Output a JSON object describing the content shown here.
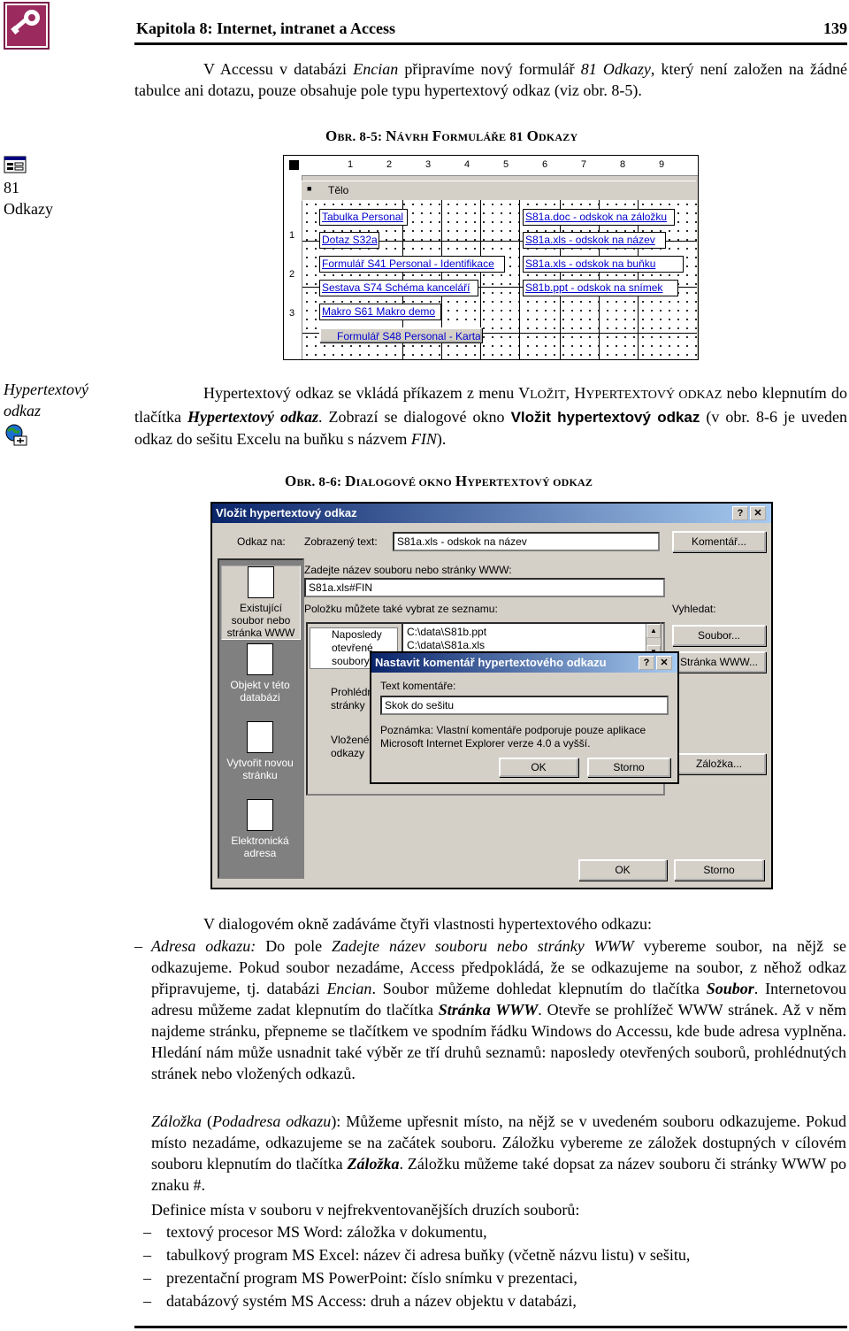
{
  "header": {
    "title": "Kapitola 8: Internet, intranet a Access",
    "page": "139"
  },
  "intro": {
    "pre": "V Accessu v databázi ",
    "db": "Encian",
    "mid": " připravíme nový formulář ",
    "form": "81 Odkazy",
    "post": ", který není založen na žádné tabulce ani dotazu, pouze obsahuje pole typu hypertextový odkaz (viz obr. 8-5)."
  },
  "fig1_caption": {
    "obr_o": "O",
    "obr_rest": "BR",
    "num": ". 8-5: ",
    "w1_n": "N",
    "w1_rest": "ÁVRH",
    "w2_f": "F",
    "w2_rest": "ORMULÁŘE",
    "w3": " 81 ",
    "w4_o": "O",
    "w4_rest": "DKAZY"
  },
  "side1": {
    "icon": "form-icon",
    "line1": "81",
    "line2": "Odkazy"
  },
  "form_design": {
    "ruler_numbers": [
      "1",
      "2",
      "3",
      "4",
      "5",
      "6",
      "7",
      "8",
      "9"
    ],
    "left_ruler": [
      "1",
      "2",
      "3"
    ],
    "section": "Tělo",
    "links_left": [
      "Tabulka Personal",
      "Dotaz S32a",
      "Formulář S41 Personal - Identifikace",
      "Sestava S74 Schéma kanceláří",
      "Makro S61 Makro demo",
      "Formulář S48 Personal - Karta"
    ],
    "links_right": [
      "S81a.doc - odskok na záložku",
      "S81a.xls - odskok na název",
      "S81a.xls - odskok na buňku",
      "S81b.ppt - odskok na snímek"
    ]
  },
  "side2": {
    "line1": "Hypertextový",
    "line2": "odkaz",
    "icon": "hyperlink-icon"
  },
  "para2": {
    "pre": "Hypertextový odkaz se vkládá příkazem z menu ",
    "menu1_cap": "V",
    "menu1_rest": "LOŽIT",
    "sep": ", ",
    "menu2_cap": "H",
    "menu2_rest": "YPERTEXTOVÝ ODKAZ",
    "mid": " nebo klepnutím do tlačítka ",
    "btn": "Hypertextový odkaz",
    "mid2": ". Zobrazí se dialogové okno ",
    "dlg": "Vložit hypertextový odkaz",
    "post1": " (v obr. 8-6 je uveden odkaz do sešitu Excelu na buňku s názvem ",
    "fin": "FIN",
    "post2": ")."
  },
  "fig2_caption": {
    "obr_o": "O",
    "obr_rest": "BR",
    "num": ". 8-6: ",
    "w1_d": "D",
    "w1_rest": "IALOGOVÉ OKNO",
    "w2_h": "H",
    "w2_rest": "YPERTEXTOVÝ ODKAZ"
  },
  "dialog": {
    "title": "Vložit hypertextový odkaz",
    "help": "?",
    "close": "✕",
    "link_to": "Odkaz na:",
    "display_text_label": "Zobrazený text:",
    "display_text_value": "S81a.xls - odskok na název",
    "comment_btn": "Komentář...",
    "file_label": "Zadejte název souboru nebo stránky WWW:",
    "file_value": "S81a.xls#FIN",
    "list_label": "Položku můžete také vybrat ze seznamu:",
    "search_label": "Vyhledat:",
    "file_btn": "Soubor...",
    "web_btn": "Stránka WWW...",
    "bookmark_btn": "Záložka...",
    "ok": "OK",
    "cancel": "Storno",
    "side_items": [
      {
        "l1": "Existující",
        "l2": "soubor nebo",
        "l3": "stránka WWW"
      },
      {
        "l1": "Objekt v této",
        "l2": "databázi",
        "l3": ""
      },
      {
        "l1": "Vytvořit novou",
        "l2": "stránku",
        "l3": ""
      },
      {
        "l1": "Elektronická",
        "l2": "adresa",
        "l3": ""
      }
    ],
    "tabs": [
      {
        "l1": "Naposledy",
        "l2": "otevřené",
        "l3": "soubory"
      },
      {
        "l1": "Prohlédnuté",
        "l2": "stránky"
      },
      {
        "l1": "Vložené",
        "l2": "odkazy"
      }
    ],
    "files": [
      "C:\\data\\S81b.ppt",
      "C:\\data\\S81a.xls"
    ]
  },
  "subdialog": {
    "title": "Nastavit komentář hypertextového odkazu",
    "help": "?",
    "close": "✕",
    "label": "Text komentáře:",
    "value": "Skok do sešitu",
    "note1": "Poznámka: Vlastní komentáře podporuje pouze aplikace",
    "note2": "Microsoft Internet Explorer verze 4.0 a vyšší.",
    "ok": "OK",
    "cancel": "Storno"
  },
  "para3": "V dialogovém okně zadáváme čtyři vlastnosti hypertextového odkazu:",
  "item1": {
    "dash": "–",
    "lines": [
      "Do pole",
      "vybereme soubor, na",
      "nějž se odkazujeme. Pokud soubor nezadáme, Access předpokládá, že se odkazujeme na",
      "soubor, z něhož odkaz připravujeme, tj. databázi",
      ". Soubor můžeme dohledat",
      "klepnutím do tlačítka",
      ". Internetovou adresu můžeme zadat klepnutím do tlačítka",
      ". Otevře se prohlížeč WWW stránek. Až v něm najdeme stránku, přepneme se",
      "tlačítkem ve spodním řádku Windows do Accessu, kde bude adresa vyplněna. Hledání nám",
      "může usnadnit také výběr ze tří druhů seznamů: naposledy otevřených souborů,",
      "prohlédnutých stránek nebo vložených odkazů."
    ],
    "term": "Adresa odkazu:",
    "field": "Zadejte název souboru nebo stránky WWW",
    "db": "Encian",
    "soubor": "Soubor",
    "stranka": "Stránka WWW"
  },
  "item2": {
    "term": "Záložka",
    "paren_open": " (",
    "term2": "Podadresa odkazu",
    "paren_close": "):",
    "l1": " Můžeme upřesnit místo, na nějž se v uvedeném souboru",
    "l2": "odkazujeme. Pokud místo nezadáme, odkazujeme se na začátek souboru. Záložku vybereme",
    "l3a": "ze záložek dostupných v cílovém souboru klepnutím do tlačítka ",
    "l3b": "Záložka",
    "l3c": ". Záložku můžeme",
    "l4": "také dopsat za název souboru či stránky WWW po znaku #."
  },
  "item3": "Definice místa v souboru v nejfrekventovanějších druzích souborů:",
  "bullets": [
    "textový procesor MS Word: záložka v dokumentu,",
    "tabulkový program MS Excel: název či adresa buňky (včetně názvu listu) v sešitu,",
    "prezentační program MS PowerPoint: číslo snímku v prezentaci,",
    "databázový systém MS Access: druh a název objektu v databázi,"
  ],
  "bullet_dash": "–"
}
